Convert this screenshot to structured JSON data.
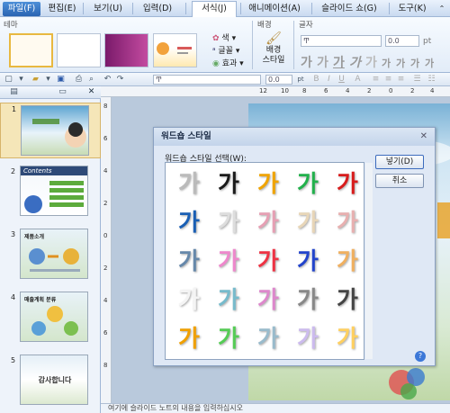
{
  "menubar": {
    "items": [
      "파일(F)",
      "편집(E)",
      "보기(U)",
      "입력(D)",
      "서식(J)",
      "애니메이션(A)",
      "슬라이드 쇼(G)",
      "도구(K)"
    ]
  },
  "ribbon": {
    "theme_group": "테마",
    "color_label": "색",
    "font_label": "글꼴",
    "effect_label": "효과",
    "background_group": "배경",
    "background_style_l1": "배경",
    "background_style_l2": "스타일",
    "text_group": "글자",
    "font_name": "Ͳ",
    "font_size": "0.0",
    "size_unit": "pt",
    "wordart_preview": "가",
    "font_panel_label": "글꼴"
  },
  "toolbar": {
    "font_name": "Ͳ",
    "size": "0.0",
    "unit": "pt"
  },
  "slides": [
    {
      "num": "1"
    },
    {
      "num": "2",
      "title": "Contents"
    },
    {
      "num": "3",
      "title": "제품소개"
    },
    {
      "num": "4",
      "title": "매출계획 분류"
    },
    {
      "num": "5",
      "text": "감사합니다"
    }
  ],
  "ruler": {
    "h": [
      "12",
      "10",
      "8",
      "6",
      "4",
      "2",
      "0",
      "2",
      "4",
      "6",
      "8"
    ],
    "v": [
      "8",
      "6",
      "4",
      "2",
      "0",
      "2",
      "4",
      "6",
      "8"
    ]
  },
  "status": {
    "text": "여기에 슬라이드 노트의 내용을 입력하십시오"
  },
  "dialog": {
    "title": "워드숍 스타일",
    "prompt": "워드숍 스타일 선택(W):",
    "insert_button": "넣기(D)",
    "cancel_button": "취소",
    "glyph": "가",
    "styles": [
      [
        "#bbbbbb",
        "#1a1a1a",
        "#f0a400",
        "#22b14c",
        "#d81c1c"
      ],
      [
        "#1a5fb4",
        "#dddddd",
        "#e6a0b4",
        "#e8d6b8",
        "#e8b0b0"
      ],
      [
        "#6688aa",
        "#ee88cc",
        "#ee3344",
        "#2244cc",
        "#f0b060"
      ],
      [
        "#f4f4f4",
        "#77bbcc",
        "#dd88cc",
        "#888888",
        "#444444"
      ],
      [
        "#f0a000",
        "#55cc55",
        "#99bbcc",
        "#ccbbee",
        "#ffd060"
      ]
    ]
  }
}
